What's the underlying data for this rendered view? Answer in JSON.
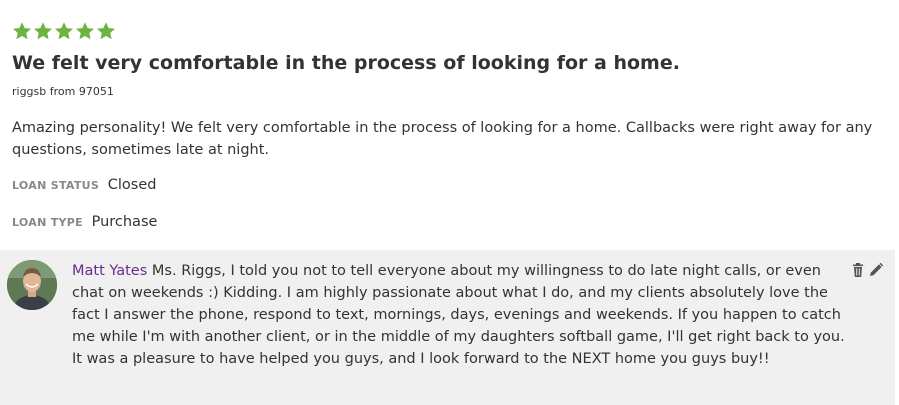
{
  "review": {
    "rating": 5,
    "rating_max": 5,
    "star_color": "#6cb33f",
    "headline": "We felt very comfortable in the process of looking for a home.",
    "author": "riggsb from 97051",
    "body": "Amazing personality! We felt very comfortable in the process of looking for a home. Callbacks were right away for any questions, sometimes late at night.",
    "loan_status": {
      "label": "LOAN STATUS",
      "value": "Closed"
    },
    "loan_type": {
      "label": "LOAN TYPE",
      "value": "Purchase"
    }
  },
  "reply": {
    "name": "Matt Yates",
    "name_color": "#6a2c91",
    "text": "Ms. Riggs, I told you not to tell everyone about my willingness to do late night calls, or even chat on weekends :) Kidding. I am highly passionate about what I do, and my clients absolutely love the fact I answer the phone, respond to text, mornings, days, evenings and weekends. If you happen to catch me while I'm with another client, or in the middle of my daughters softball game, I'll get right back to you. It was a pleasure to have helped you guys, and I look forward to the NEXT home you guys buy!!",
    "actions": [
      "trash-icon",
      "pencil-icon"
    ]
  }
}
